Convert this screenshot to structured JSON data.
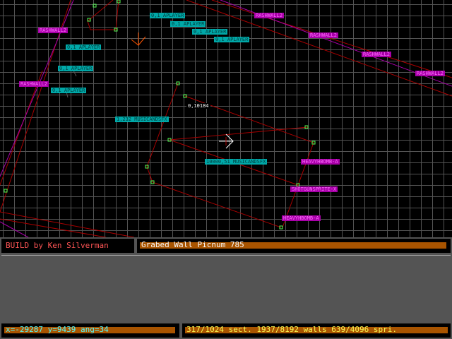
{
  "app": {
    "title": "BUILD by Ken Silverman",
    "message": "Grabed Wall Picnum 785"
  },
  "status": {
    "coords": "x=-29287 y=9439 ang=34",
    "counts": "317/1024 sect. 1937/8192 walls 639/4096 spri."
  },
  "labels": {
    "cyan": [
      "0,1 APLAYER",
      "0,1 APLAYER",
      "0,1 APLAYER",
      "0,1 APLAYER",
      "0,1 APLAYER",
      "0,1 APLAYER",
      "0,1 APLAYER",
      "1,232 MUSICANDSFX",
      "10000,51 MUSICANDSFX"
    ],
    "magenta": [
      "RASHWALL2",
      "RASHWALL2",
      "RASHWALL2",
      "RASHWALL2",
      "RASHWALL2",
      "RASHWALL2",
      "HEAVYHBOMB-A",
      "SHOTGUNSPRITE-X",
      "HEAVYHBOMB-A"
    ],
    "white": [
      "0,10184"
    ]
  },
  "colors": {
    "grid": "#545454",
    "wall_red": "#a80000",
    "wall_magenta": "#a800a8",
    "vertex": "#54fc54",
    "sprite_orange": "#fc5400",
    "cursor": "#fcfcfc"
  },
  "icons": {
    "cursor": "crosshair-arrow-icon",
    "sprite_marker": "sprite-arrow-icon"
  }
}
